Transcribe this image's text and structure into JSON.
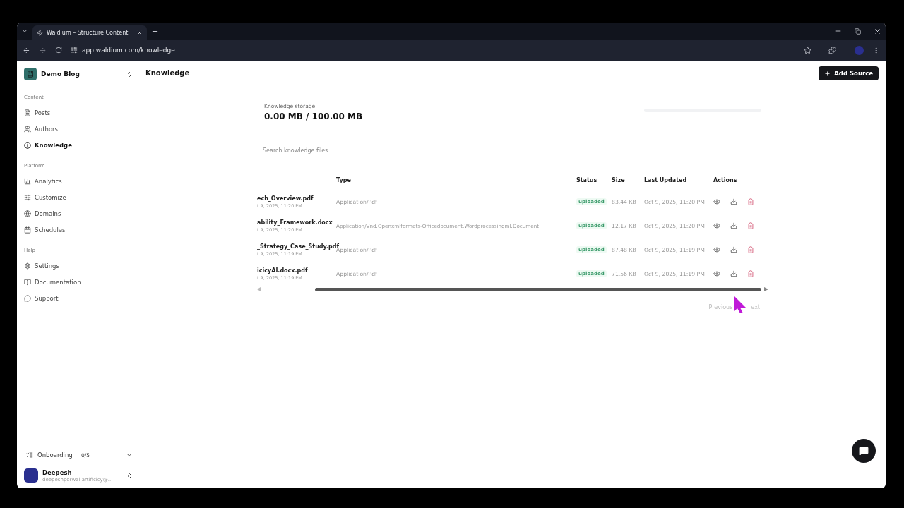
{
  "browser": {
    "tab_title": "Waldium – Structure Content",
    "url": "app.waldium.com/knowledge"
  },
  "sidebar": {
    "workspace": "Demo Blog",
    "sections": [
      {
        "title": "Content",
        "items": [
          {
            "label": "Posts",
            "selected": false
          },
          {
            "label": "Authors",
            "selected": false
          },
          {
            "label": "Knowledge",
            "selected": true
          }
        ]
      },
      {
        "title": "Platform",
        "items": [
          {
            "label": "Analytics",
            "selected": false
          },
          {
            "label": "Customize",
            "selected": false
          },
          {
            "label": "Domains",
            "selected": false
          },
          {
            "label": "Schedules",
            "selected": false
          }
        ]
      },
      {
        "title": "Help",
        "items": [
          {
            "label": "Settings",
            "selected": false
          },
          {
            "label": "Documentation",
            "selected": false
          },
          {
            "label": "Support",
            "selected": false
          }
        ]
      }
    ],
    "onboarding": {
      "label": "Onboarding",
      "count": "0/5"
    },
    "user": {
      "name": "Deepesh",
      "email": "deepeshporwal.artificicy@..."
    }
  },
  "page": {
    "title": "Knowledge",
    "add_button": "Add Source"
  },
  "storage": {
    "label": "Knowledge storage",
    "value": "0.00 MB / 100.00 MB",
    "level": 0
  },
  "search": {
    "placeholder": "Search knowledge files..."
  },
  "table": {
    "columns": [
      "Type",
      "Status",
      "Size",
      "Last Updated",
      "Actions"
    ],
    "rows": [
      {
        "name": "ech_Overview.pdf",
        "created": "t 9, 2025, 11:20 PM",
        "type": "Application/Pdf",
        "status": "uploaded",
        "size": "83.44 KB",
        "updated": "Oct 9, 2025, 11:20 PM"
      },
      {
        "name": "ability_Framework.docx",
        "created": "t 9, 2025, 11:20 PM",
        "type": "Application/Vnd.Openxmlformats-Officedocument.Wordprocessingml.Document",
        "status": "uploaded",
        "size": "12.17 KB",
        "updated": "Oct 9, 2025, 11:20 PM"
      },
      {
        "name": "_Strategy_Case_Study.pdf",
        "created": "t 9, 2025, 11:19 PM",
        "type": "Application/Pdf",
        "status": "uploaded",
        "size": "87.48 KB",
        "updated": "Oct 9, 2025, 11:19 PM"
      },
      {
        "name": "icicyAI.docx.pdf",
        "created": "t 9, 2025, 11:19 PM",
        "type": "Application/Pdf",
        "status": "uploaded",
        "size": "71.56 KB",
        "updated": "Oct 9, 2025, 11:19 PM"
      }
    ]
  },
  "pagination": {
    "previous": "Previous",
    "next": "ext"
  }
}
